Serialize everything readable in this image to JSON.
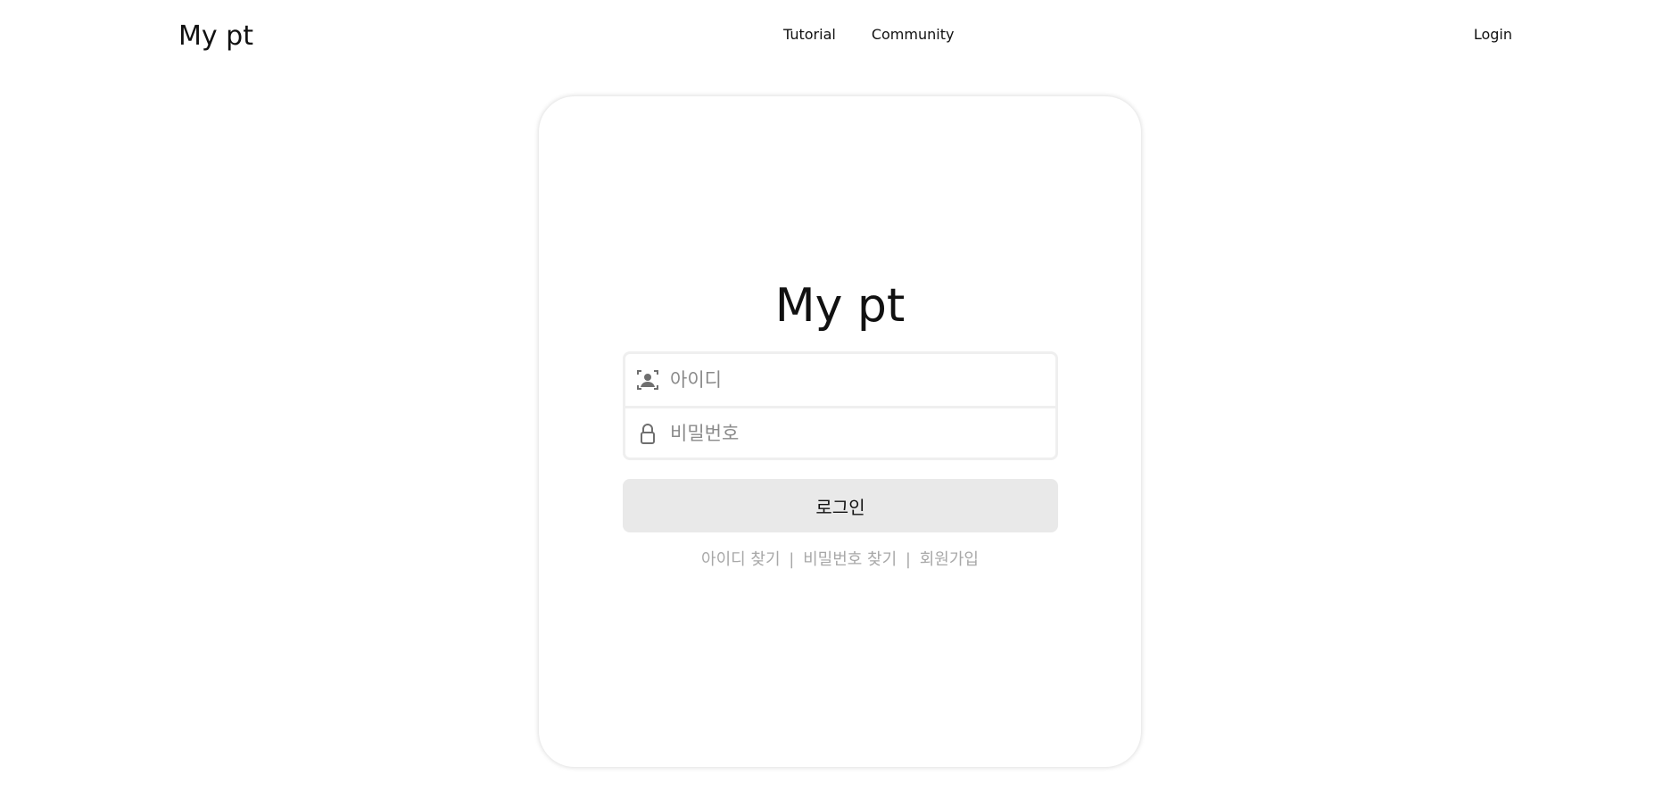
{
  "header": {
    "brand": "My pt",
    "nav": [
      {
        "label": "Tutorial"
      },
      {
        "label": "Community"
      }
    ],
    "login_label": "Login"
  },
  "login_card": {
    "title": "My pt",
    "id_field": {
      "placeholder": "아이디",
      "value": "",
      "icon": "user-id-icon"
    },
    "password_field": {
      "placeholder": "비밀번호",
      "value": "",
      "icon": "lock-icon"
    },
    "submit_label": "로그인",
    "links": {
      "find_id": "아이디 찾기",
      "find_password": "비밀번호 찾기",
      "sign_up": "회원가입",
      "separator": "|"
    }
  },
  "colors": {
    "button_bg": "#e9e9e9",
    "field_border": "#efefef",
    "helper_text": "#a8a8a8"
  }
}
